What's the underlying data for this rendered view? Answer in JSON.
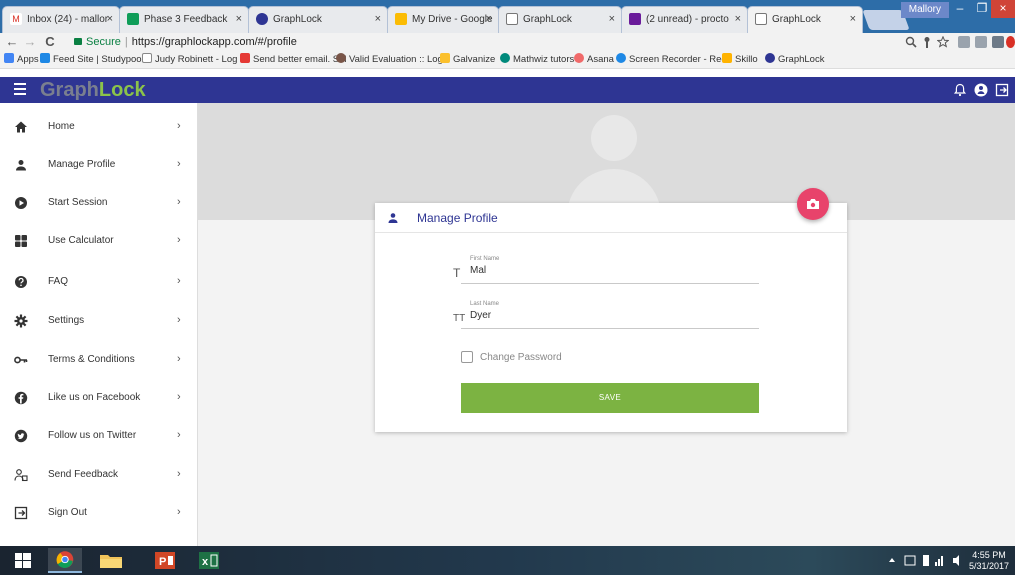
{
  "browser": {
    "tabs": [
      {
        "title": "Inbox (24) - mallor",
        "favicon": "gmail-icon"
      },
      {
        "title": "Phase 3 Feedback",
        "favicon": "sheets-icon"
      },
      {
        "title": "GraphLock",
        "favicon": "graphlock-icon"
      },
      {
        "title": "My Drive - Google",
        "favicon": "drive-icon"
      },
      {
        "title": "GraphLock",
        "favicon": "page-icon"
      },
      {
        "title": "(2 unread) - procto",
        "favicon": "mail-icon"
      },
      {
        "title": "GraphLock",
        "favicon": "page-icon",
        "active": true
      }
    ],
    "tab_close": "×",
    "user": "Mallory",
    "window_controls": {
      "minimize": "–",
      "maximize": "❐",
      "close": "×"
    },
    "nav": {
      "back": "←",
      "forward": "→",
      "reload": "C"
    },
    "url": {
      "secure_label": "Secure",
      "address": "https://graphlockapp.com/#/profile"
    },
    "bookmarks": [
      {
        "label": "Apps",
        "color": "#4285f4"
      },
      {
        "label": "Feed Site | Studypool",
        "color": "#1e88e5"
      },
      {
        "label": "Judy Robinett - Log in",
        "color": "#9e9e9e"
      },
      {
        "label": "Send better email. Sel",
        "color": "#e53935"
      },
      {
        "label": "Valid Evaluation :: Log",
        "color": "#795548"
      },
      {
        "label": "Galvanize",
        "color": "#fbc02d"
      },
      {
        "label": "Mathwiz tutors",
        "color": "#00897b"
      },
      {
        "label": "Asana",
        "color": "#f06a6a"
      },
      {
        "label": "Screen Recorder - Rec",
        "color": "#1e88e5"
      },
      {
        "label": "Skillo",
        "color": "#ffb300"
      },
      {
        "label": "GraphLock",
        "color": "#2e3593"
      }
    ]
  },
  "app": {
    "logo_part1": "Graph",
    "logo_part2": "Lock",
    "brand_color": "#2e3593",
    "accent_color": "#7cb342",
    "sidebar": [
      {
        "label": "Home",
        "icon": "home-icon"
      },
      {
        "label": "Manage Profile",
        "icon": "person-icon"
      },
      {
        "label": "Start Session",
        "icon": "play-circle-icon"
      },
      {
        "label": "Use Calculator",
        "icon": "calculator-icon"
      },
      {
        "label": "FAQ",
        "icon": "help-icon"
      },
      {
        "label": "Settings",
        "icon": "gear-icon"
      },
      {
        "label": "Terms & Conditions",
        "icon": "key-icon"
      },
      {
        "label": "Like us on Facebook",
        "icon": "facebook-icon"
      },
      {
        "label": "Follow us on Twitter",
        "icon": "twitter-icon"
      },
      {
        "label": "Send Feedback",
        "icon": "feedback-icon"
      },
      {
        "label": "Sign Out",
        "icon": "sign-out-icon"
      }
    ],
    "chevron": "›",
    "card": {
      "title": "Manage Profile",
      "first_name_label": "First Name",
      "first_name_value": "Mal",
      "last_name_label": "Last Name",
      "last_name_value": "Dyer",
      "change_password_label": "Change Password",
      "change_password_checked": false,
      "save_label": "SAVE"
    }
  },
  "taskbar": {
    "time": "4:55 PM",
    "date": "5/31/2017"
  }
}
